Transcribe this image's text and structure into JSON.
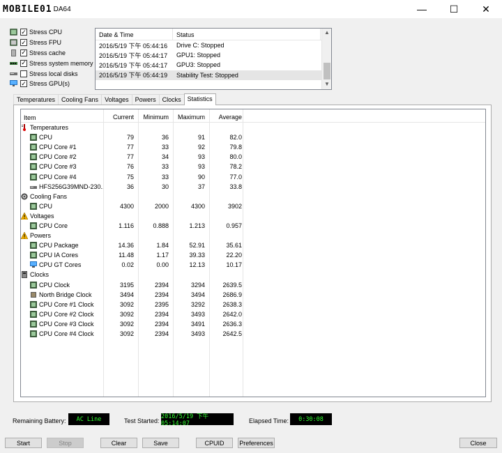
{
  "window": {
    "title_logo": "MOBILE01",
    "title_suffix": "DA64",
    "minimize_glyph": "—",
    "maximize_glyph": "☐",
    "close_glyph": "✕"
  },
  "stress_options": [
    {
      "label": "Stress CPU",
      "checked": true,
      "icon": "cpu-chip-icon"
    },
    {
      "label": "Stress FPU",
      "checked": true,
      "icon": "fpu-chip-icon"
    },
    {
      "label": "Stress cache",
      "checked": true,
      "icon": "cache-icon"
    },
    {
      "label": "Stress system memory",
      "checked": true,
      "icon": "memory-module-icon"
    },
    {
      "label": "Stress local disks",
      "checked": false,
      "icon": "disk-drive-icon"
    },
    {
      "label": "Stress GPU(s)",
      "checked": true,
      "icon": "monitor-icon"
    }
  ],
  "log": {
    "columns": [
      "Date & Time",
      "Status"
    ],
    "rows": [
      {
        "date": "2016/5/19 下午 05:44:16",
        "status": "Drive C: Stopped",
        "selected": false
      },
      {
        "date": "2016/5/19 下午 05:44:17",
        "status": "GPU1: Stopped",
        "selected": false
      },
      {
        "date": "2016/5/19 下午 05:44:17",
        "status": "GPU3: Stopped",
        "selected": false
      },
      {
        "date": "2016/5/19 下午 05:44:19",
        "status": "Stability Test: Stopped",
        "selected": true
      }
    ]
  },
  "tabs": [
    {
      "label": "Temperatures",
      "active": false
    },
    {
      "label": "Cooling Fans",
      "active": false
    },
    {
      "label": "Voltages",
      "active": false
    },
    {
      "label": "Powers",
      "active": false
    },
    {
      "label": "Clocks",
      "active": false
    },
    {
      "label": "Statistics",
      "active": true
    }
  ],
  "stats": {
    "columns": [
      "Item",
      "Current",
      "Minimum",
      "Maximum",
      "Average"
    ],
    "rows": [
      {
        "group": true,
        "icon": "thermometer-icon",
        "item": "Temperatures"
      },
      {
        "icon": "chip-icon",
        "item": "CPU",
        "current": "79",
        "minimum": "36",
        "maximum": "91",
        "average": "82.0"
      },
      {
        "icon": "chip-icon",
        "item": "CPU Core #1",
        "current": "77",
        "minimum": "33",
        "maximum": "92",
        "average": "79.8"
      },
      {
        "icon": "chip-icon",
        "item": "CPU Core #2",
        "current": "77",
        "minimum": "34",
        "maximum": "93",
        "average": "80.0"
      },
      {
        "icon": "chip-icon",
        "item": "CPU Core #3",
        "current": "76",
        "minimum": "33",
        "maximum": "93",
        "average": "78.2"
      },
      {
        "icon": "chip-icon",
        "item": "CPU Core #4",
        "current": "75",
        "minimum": "33",
        "maximum": "90",
        "average": "77.0"
      },
      {
        "icon": "disk-icon",
        "item": "HFS256G39MND-230...",
        "current": "36",
        "minimum": "30",
        "maximum": "37",
        "average": "33.8"
      },
      {
        "group": true,
        "icon": "fan-icon",
        "item": "Cooling Fans"
      },
      {
        "icon": "chip-icon",
        "item": "CPU",
        "current": "4300",
        "minimum": "2000",
        "maximum": "4300",
        "average": "3902"
      },
      {
        "group": true,
        "icon": "warning-icon",
        "item": "Voltages"
      },
      {
        "icon": "chip-icon",
        "item": "CPU Core",
        "current": "1.116",
        "minimum": "0.888",
        "maximum": "1.213",
        "average": "0.957"
      },
      {
        "group": true,
        "icon": "warning-icon",
        "item": "Powers"
      },
      {
        "icon": "chip-icon",
        "item": "CPU Package",
        "current": "14.36",
        "minimum": "1.84",
        "maximum": "52.91",
        "average": "35.61"
      },
      {
        "icon": "chip-icon",
        "item": "CPU IA Cores",
        "current": "11.48",
        "minimum": "1.17",
        "maximum": "39.33",
        "average": "22.20"
      },
      {
        "icon": "gpu-monitor-icon",
        "item": "CPU GT Cores",
        "current": "0.02",
        "minimum": "0.00",
        "maximum": "12.13",
        "average": "10.17"
      },
      {
        "group": true,
        "icon": "clock-icon",
        "item": "Clocks"
      },
      {
        "icon": "chip-icon",
        "item": "CPU Clock",
        "current": "3195",
        "minimum": "2394",
        "maximum": "3294",
        "average": "2639.5"
      },
      {
        "icon": "northbridge-icon",
        "item": "North Bridge Clock",
        "current": "3494",
        "minimum": "2394",
        "maximum": "3494",
        "average": "2686.9"
      },
      {
        "icon": "chip-icon",
        "item": "CPU Core #1 Clock",
        "current": "3092",
        "minimum": "2395",
        "maximum": "3292",
        "average": "2638.3"
      },
      {
        "icon": "chip-icon",
        "item": "CPU Core #2 Clock",
        "current": "3092",
        "minimum": "2394",
        "maximum": "3493",
        "average": "2642.0"
      },
      {
        "icon": "chip-icon",
        "item": "CPU Core #3 Clock",
        "current": "3092",
        "minimum": "2394",
        "maximum": "3491",
        "average": "2636.3"
      },
      {
        "icon": "chip-icon",
        "item": "CPU Core #4 Clock",
        "current": "3092",
        "minimum": "2394",
        "maximum": "3493",
        "average": "2642.5"
      }
    ]
  },
  "status_bar": {
    "remaining_battery_label": "Remaining Battery:",
    "remaining_battery_value": "AC Line",
    "test_started_label": "Test Started:",
    "test_started_value": "2016/5/19 下午 05:14:07",
    "elapsed_time_label": "Elapsed Time:",
    "elapsed_time_value": "0:30:08",
    "lcd_text_color": "#30ff30",
    "lcd_background": "#000000"
  },
  "buttons": {
    "start": "Start",
    "stop": "Stop",
    "clear": "Clear",
    "save": "Save",
    "cpuid": "CPUID",
    "preferences": "Preferences",
    "close": "Close"
  }
}
